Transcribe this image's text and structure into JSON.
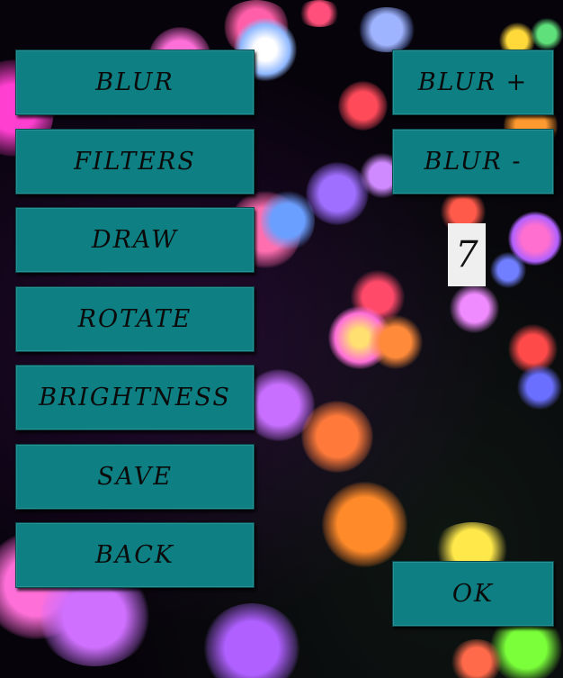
{
  "menu": {
    "blur_label": "BLUR",
    "filters_label": "FILTERS",
    "draw_label": "DRAW",
    "rotate_label": "ROTATE",
    "brightness_label": "BRIGHTNESS",
    "save_label": "SAVE",
    "back_label": "BACK"
  },
  "blur_panel": {
    "increase_label": "BLUR +",
    "decrease_label": "BLUR -",
    "value": "7",
    "ok_label": "OK"
  },
  "colors": {
    "button_fill": "#0e7f82",
    "button_text": "#0a0a0a",
    "value_box": "#efefef"
  }
}
